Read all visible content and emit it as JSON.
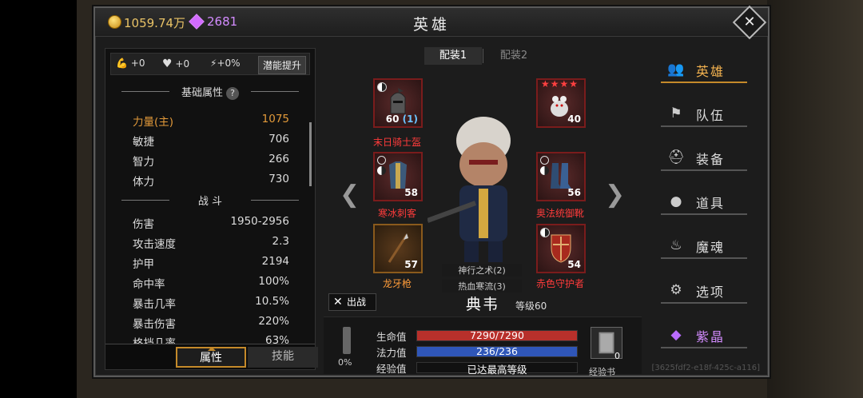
{
  "header": {
    "title": "英雄",
    "gold": "1059.74万",
    "gems": "2681",
    "close_icon": "close-icon"
  },
  "left": {
    "top_stats": [
      {
        "icon": "strength-arm-icon",
        "value": "+0"
      },
      {
        "icon": "heart-icon",
        "value": "+0"
      },
      {
        "icon": "lightning-icon",
        "value": "+0%"
      }
    ],
    "potential_label": "潜能提升",
    "base_title": "基础属性",
    "base": [
      {
        "label": "力量(主)",
        "value": "1075"
      },
      {
        "label": "敏捷",
        "value": "706"
      },
      {
        "label": "智力",
        "value": "266"
      },
      {
        "label": "体力",
        "value": "730"
      }
    ],
    "combat_title": "战 斗",
    "combat": [
      {
        "label": "伤害",
        "value": "1950-2956"
      },
      {
        "label": "攻击速度",
        "value": "2.3"
      },
      {
        "label": "护甲",
        "value": "2194"
      },
      {
        "label": "命中率",
        "value": "100%"
      },
      {
        "label": "暴击几率",
        "value": "10.5%"
      },
      {
        "label": "暴击伤害",
        "value": "220%"
      },
      {
        "label": "格挡几率",
        "value": "63%"
      }
    ],
    "tabs": [
      "属性",
      "技能"
    ]
  },
  "center": {
    "loadouts": [
      "配装1",
      "配装2"
    ],
    "equipment": [
      {
        "name": "末日骑士盔",
        "level": "60",
        "extra": "(1)"
      },
      {
        "name": "",
        "level": "40"
      },
      {
        "name": "寒冰刺客",
        "level": "58"
      },
      {
        "name": "奥法统御靴",
        "level": "56"
      },
      {
        "name": "龙牙枪",
        "level": "57"
      },
      {
        "name": "赤色守护者",
        "level": "54"
      }
    ],
    "skills": [
      "神行之术(2)",
      "热血寒流(3)"
    ],
    "battle_label": "出战",
    "hero_name": "典韦",
    "hero_level": "等级60",
    "hp_label": "生命值",
    "hp_text": "7290/7290",
    "hp_fraction": 1.0,
    "mp_label": "法力值",
    "mp_text": "236/236",
    "mp_fraction": 1.0,
    "xp_label": "经验值",
    "xp_text": "已达最高等级",
    "weapon_pct": "0%",
    "book_count": "0",
    "book_label": "经验书"
  },
  "nav": [
    {
      "label": "英雄",
      "icon": "hero-icon"
    },
    {
      "label": "队伍",
      "icon": "flag-icon"
    },
    {
      "label": "装备",
      "icon": "helmet-icon"
    },
    {
      "label": "道具",
      "icon": "bag-icon"
    },
    {
      "label": "魔魂",
      "icon": "flame-icon"
    },
    {
      "label": "选项",
      "icon": "gear-icon"
    },
    {
      "label": "紫晶",
      "icon": "crystal-icon"
    }
  ],
  "uid": "[3625fdf2-e18f-425c-a116]",
  "colors": {
    "accent": "#c58a2a",
    "hp": "#b8302b",
    "mp": "#2f56b8",
    "red_item": "#ff3b3b",
    "orange_item": "#ff9c3a"
  }
}
